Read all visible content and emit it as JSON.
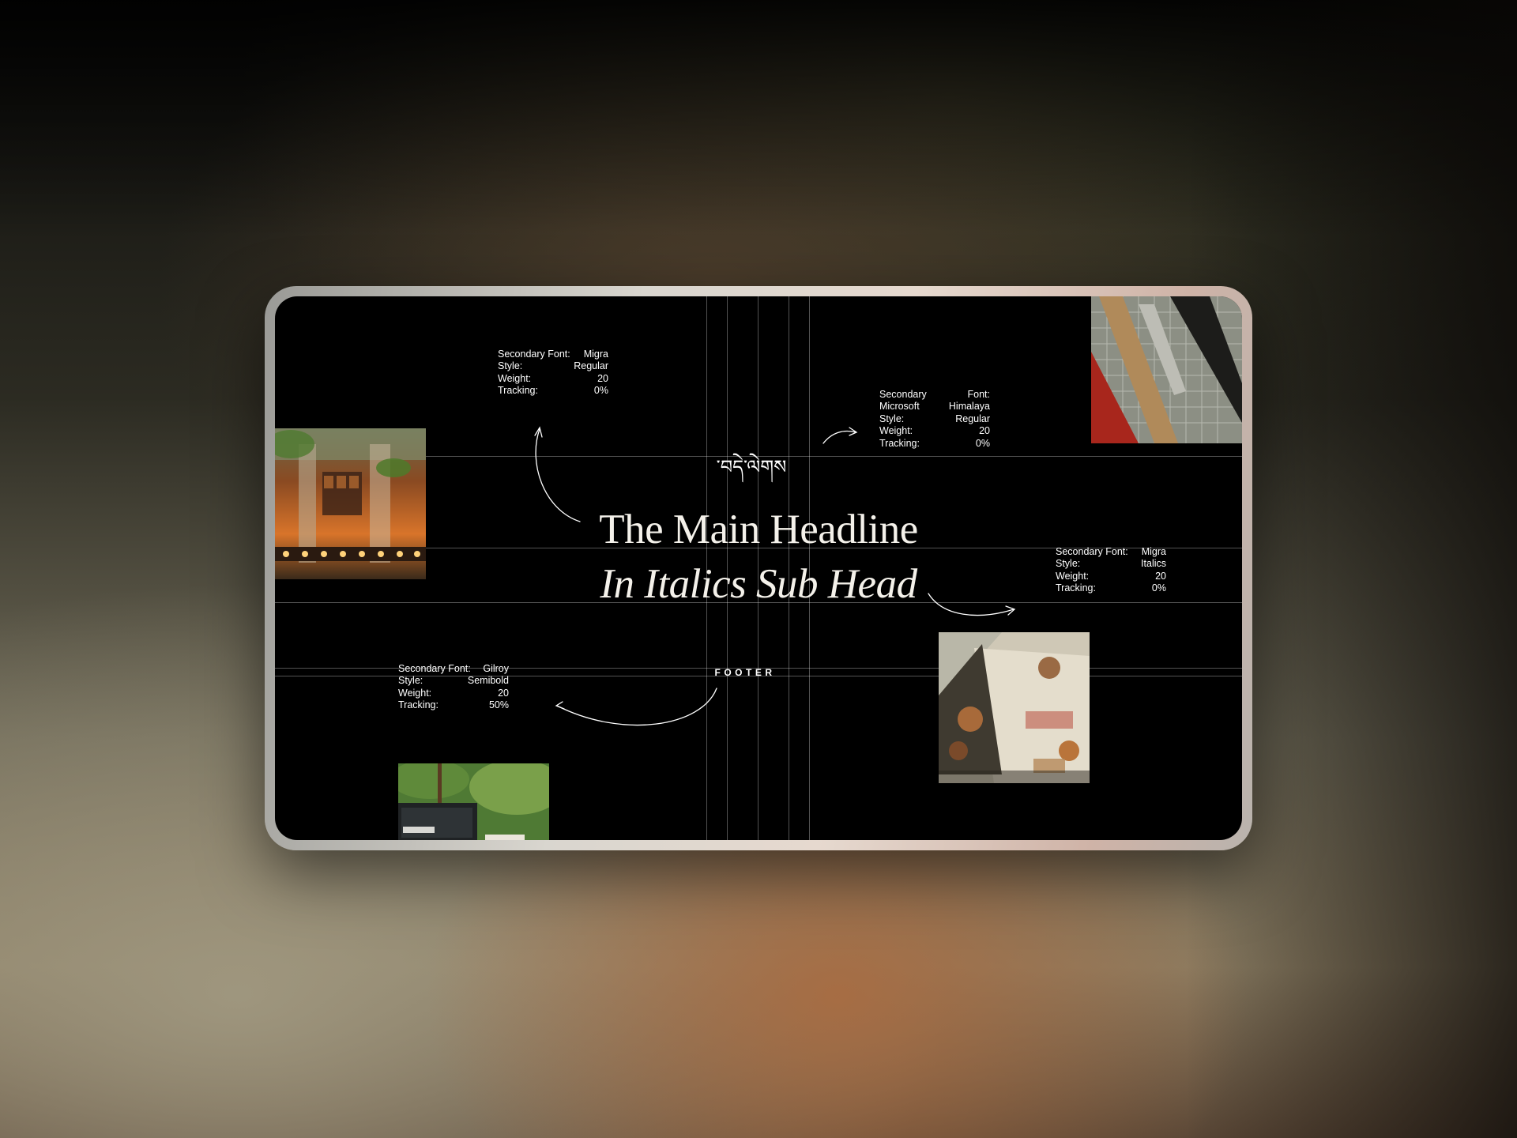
{
  "script_text": "་བདེ་ལེགས",
  "headline": "The Main Headline",
  "subhead": "In Italics Sub Head",
  "footer_label": "FOOTER",
  "specs": {
    "migra_regular": {
      "rows": [
        {
          "k": "Secondary  Font:",
          "v": "Migra"
        },
        {
          "k": "Style:",
          "v": "Regular"
        },
        {
          "k": "Weight:",
          "v": "20"
        },
        {
          "k": "Tracking:",
          "v": "0%"
        }
      ]
    },
    "himalaya": {
      "rows": [
        {
          "k": "Secondary",
          "v": "Font:"
        },
        {
          "k": "Microsoft",
          "v": "Himalaya"
        },
        {
          "k": "Style:",
          "v": "Regular"
        },
        {
          "k": "Weight:",
          "v": "20"
        },
        {
          "k": "Tracking:",
          "v": "0%"
        }
      ]
    },
    "migra_italics": {
      "rows": [
        {
          "k": "Secondary  Font:",
          "v": "Migra"
        },
        {
          "k": "Style:",
          "v": "Italics"
        },
        {
          "k": "Weight:",
          "v": "20"
        },
        {
          "k": "Tracking:",
          "v": "0%"
        }
      ]
    },
    "gilroy": {
      "rows": [
        {
          "k": "Secondary  Font:",
          "v": "Gilroy"
        },
        {
          "k": "Style:",
          "v": "Semibold"
        },
        {
          "k": "Weight:",
          "v": "20"
        },
        {
          "k": "Tracking:",
          "v": "50%"
        }
      ]
    }
  },
  "colors": {
    "screen_bg": "#000000",
    "text": "#ffffff",
    "guide_lines": "rgba(255,255,255,0.32)"
  }
}
